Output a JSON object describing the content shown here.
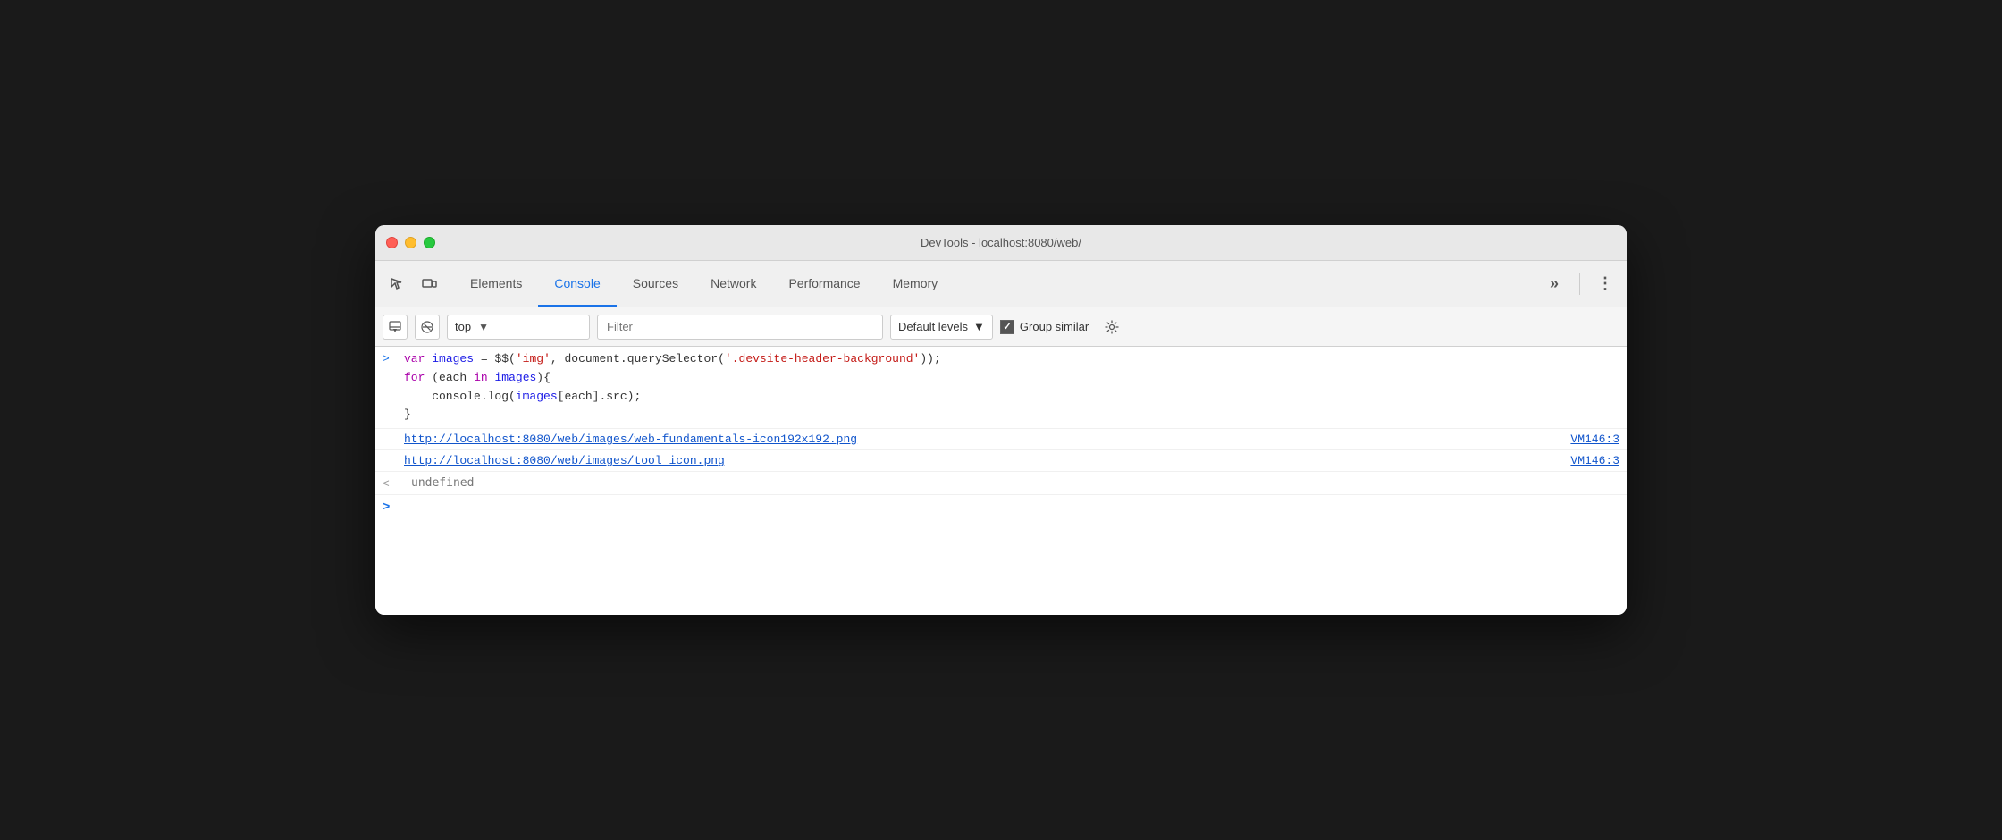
{
  "titlebar": {
    "title": "DevTools - localhost:8080/web/"
  },
  "tabs": {
    "items": [
      {
        "id": "elements",
        "label": "Elements",
        "active": false
      },
      {
        "id": "console",
        "label": "Console",
        "active": true
      },
      {
        "id": "sources",
        "label": "Sources",
        "active": false
      },
      {
        "id": "network",
        "label": "Network",
        "active": false
      },
      {
        "id": "performance",
        "label": "Performance",
        "active": false
      },
      {
        "id": "memory",
        "label": "Memory",
        "active": false
      }
    ],
    "more_label": "»",
    "kebab_label": "⋮"
  },
  "console_toolbar": {
    "context_value": "top",
    "context_arrow": "▼",
    "filter_placeholder": "Filter",
    "default_levels_label": "Default levels",
    "default_levels_arrow": "▼",
    "group_similar_label": "Group similar",
    "clear_icon": "🚫",
    "settings_icon": "⚙"
  },
  "console_entries": {
    "prompt": ">",
    "result_prompt": "<",
    "code_lines": [
      "var images = $$('img', document.querySelector('.devsite-header-background'));",
      "for (each in images){",
      "    console.log(images[each].src);",
      "}"
    ],
    "link1": "http://localhost:8080/web/images/web-fundamentals-icon192x192.png",
    "link1_ref": "VM146:3",
    "link2": "http://localhost:8080/web/images/tool_icon.png",
    "link2_ref": "VM146:3",
    "undefined_text": "undefined",
    "cursor_prompt": ">"
  },
  "colors": {
    "active_tab": "#1a73e8",
    "keyword": "#aa00aa",
    "variable": "#1a1ae6",
    "string": "#c41a16",
    "link": "#1155cc"
  }
}
